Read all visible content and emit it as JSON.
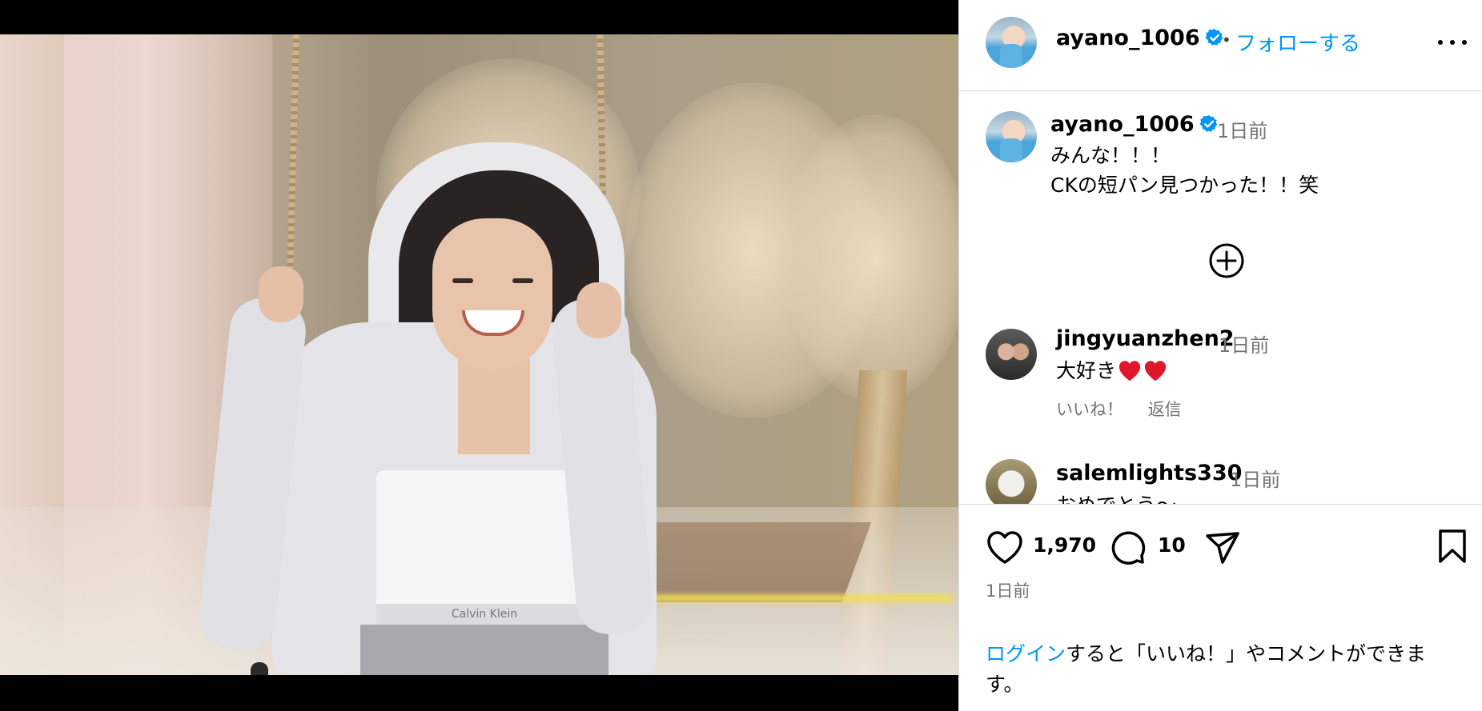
{
  "header": {
    "username": "ayano_1006",
    "separator": "•",
    "follow_label": "フォローする",
    "more_icon": "more-horizontal-icon"
  },
  "caption": {
    "username": "ayano_1006",
    "time": "1日前",
    "text": "みんな！！！\nCKの短パン見つかった！！笑"
  },
  "photo": {
    "waistband_text": "Calvin Klein"
  },
  "comments": [
    {
      "username": "jingyuanzhen2",
      "time": "1日前",
      "text": "大好き",
      "emoji": [
        "red-heart-icon",
        "red-heart-icon"
      ],
      "like_label": "いいね！",
      "reply_label": "返信"
    },
    {
      "username": "salemlights330",
      "time": "1日前",
      "text": "おめでとう〜"
    }
  ],
  "actions": {
    "like_count": "1,970",
    "comment_count": "10",
    "post_time": "1日前"
  },
  "login_prompt": {
    "link_text": "ログイン",
    "rest_text": "すると「いいね！」やコメントができます。"
  },
  "colors": {
    "accent": "#0095f6",
    "verified": "#0095f6",
    "secondary_text": "#737373",
    "divider": "#dbdbdb"
  }
}
